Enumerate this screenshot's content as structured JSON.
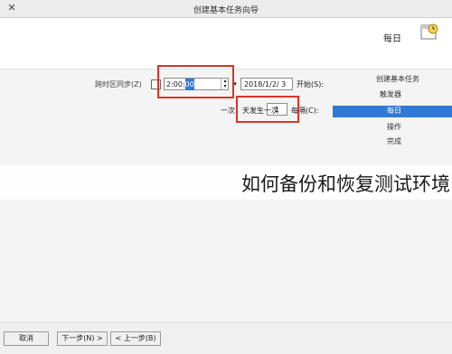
{
  "window": {
    "title": "创建基本任务向导",
    "close_glyph": "✕"
  },
  "header": {
    "title": "每日",
    "icon": "clock-calendar-icon"
  },
  "nav": {
    "items": [
      {
        "label": "创建基本任务"
      },
      {
        "label": "触发器"
      },
      {
        "label": "每日"
      },
      {
        "label": "操作"
      },
      {
        "label": "完成"
      }
    ],
    "selected_index": 2
  },
  "form": {
    "start_label": "开始(S):",
    "date_value": "2018/1/2/ 3",
    "time_value_prefix": "2:00:",
    "time_value_selected": "00",
    "sync_label": "跨时区同步(Z)",
    "sync_checked": false,
    "recur_label": "每隔(C):",
    "recur_value": "1",
    "recur_suffix": "天发生一次",
    "once_label": "一次"
  },
  "overlay": {
    "banner_text": "如何备份和恢复测试环境"
  },
  "buttons": {
    "cancel": "取消",
    "next": "下一步(N) >",
    "prev": "< 上一步(B)"
  },
  "colors": {
    "highlight": "#d9342b",
    "selection": "#2f7ad6"
  }
}
